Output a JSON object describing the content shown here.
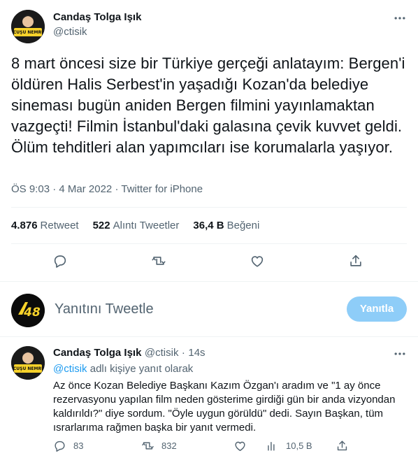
{
  "colors": {
    "accent": "#1d9bf0",
    "text": "#0f1419",
    "muted": "#536471",
    "divider": "#eff3f4",
    "reply_button_bg": "#8ecdf8",
    "avatar_yellow": "#f7d22a"
  },
  "tweet": {
    "author_name": "Candaş Tolga Işık",
    "author_handle": "@ctisik",
    "more_icon": "more-icon",
    "text": "8 mart öncesi size bir Türkiye gerçeği anlatayım: Bergen'i öldüren Halis Serbest'in yaşadığı Kozan'da belediye sineması bugün aniden Bergen filmini yayınlamaktan vazgeçti! Filmin İstanbul'daki galasına çevik kuvvet geldi. Ölüm tehditleri alan yapımcıları ise korumalarla yaşıyor.",
    "time": "ÖS 9:03",
    "date": "4 Mar 2022",
    "source": "Twitter for iPhone",
    "separator": "·",
    "stats": {
      "retweets_count": "4.876",
      "retweets_label": "Retweet",
      "quotes_count": "522",
      "quotes_label": "Alıntı Tweetler",
      "likes_count": "36,4 B",
      "likes_label": "Beğeni"
    },
    "actions": [
      "reply-icon",
      "retweet-icon",
      "like-icon",
      "share-icon"
    ]
  },
  "compose": {
    "placeholder": "Yanıtını Tweetle",
    "button_label": "Yanıtla",
    "avatar_text": "48"
  },
  "reply": {
    "author_name": "Candaş Tolga Işık",
    "author_handle": "@ctisik",
    "time": "14s",
    "separator": "·",
    "replying_handle": "@ctisik",
    "replying_suffix": "adlı kişiye yanıt olarak",
    "text": "Az önce Kozan Belediye Başkanı Kazım Özgan'ı aradım ve \"1 ay önce rezervasyonu yapılan film neden gösterime girdiği gün bir anda vizyondan kaldırıldı?\" diye sordum. \"Öyle uygun görüldü\" dedi. Sayın Başkan, tüm ısrarlarıma rağmen başka bir yanıt vermedi.",
    "reply_count": "83",
    "retweet_count": "832",
    "like_count": "",
    "views_count": "10,5 B"
  }
}
